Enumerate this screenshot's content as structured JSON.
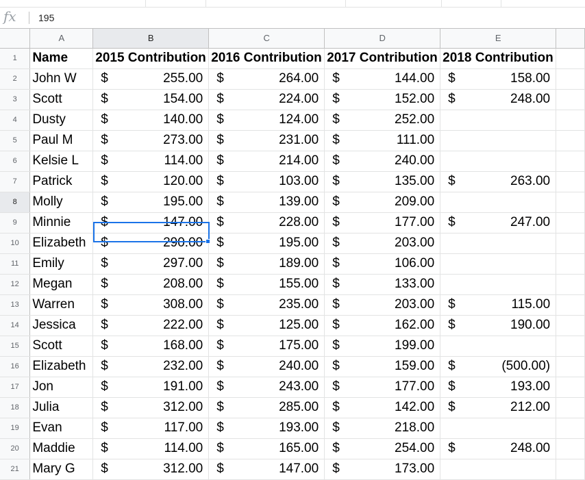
{
  "formula_bar": {
    "fx_label": "fx",
    "value": "195"
  },
  "columns": [
    "A",
    "B",
    "C",
    "D",
    "E"
  ],
  "header": [
    "Name",
    "2015 Contribution",
    "2016 Contribution",
    "2017 Contribution",
    "2018 Contribution"
  ],
  "selected": {
    "row": 8,
    "col": "B"
  },
  "rows": [
    {
      "num": "2",
      "name": "John W",
      "vals": [
        "255.00",
        "264.00",
        "144.00",
        "158.00"
      ]
    },
    {
      "num": "3",
      "name": "Scott",
      "vals": [
        "154.00",
        "224.00",
        "152.00",
        "248.00"
      ]
    },
    {
      "num": "4",
      "name": "Dusty",
      "vals": [
        "140.00",
        "124.00",
        "252.00",
        ""
      ]
    },
    {
      "num": "5",
      "name": "Paul M",
      "vals": [
        "273.00",
        "231.00",
        "111.00",
        ""
      ]
    },
    {
      "num": "6",
      "name": "Kelsie L",
      "vals": [
        "114.00",
        "214.00",
        "240.00",
        ""
      ]
    },
    {
      "num": "7",
      "name": "Patrick",
      "vals": [
        "120.00",
        "103.00",
        "135.00",
        "263.00"
      ]
    },
    {
      "num": "8",
      "name": "Molly",
      "vals": [
        "195.00",
        "139.00",
        "209.00",
        ""
      ]
    },
    {
      "num": "9",
      "name": "Minnie",
      "vals": [
        "147.00",
        "228.00",
        "177.00",
        "247.00"
      ]
    },
    {
      "num": "10",
      "name": "Elizabeth",
      "vals": [
        "290.00",
        "195.00",
        "203.00",
        ""
      ]
    },
    {
      "num": "11",
      "name": "Emily",
      "vals": [
        "297.00",
        "189.00",
        "106.00",
        ""
      ]
    },
    {
      "num": "12",
      "name": "Megan",
      "vals": [
        "208.00",
        "155.00",
        "133.00",
        ""
      ]
    },
    {
      "num": "13",
      "name": "Warren",
      "vals": [
        "308.00",
        "235.00",
        "203.00",
        "115.00"
      ]
    },
    {
      "num": "14",
      "name": "Jessica",
      "vals": [
        "222.00",
        "125.00",
        "162.00",
        "190.00"
      ]
    },
    {
      "num": "15",
      "name": "Scott",
      "vals": [
        "168.00",
        "175.00",
        "199.00",
        ""
      ]
    },
    {
      "num": "16",
      "name": "Elizabeth",
      "vals": [
        "232.00",
        "240.00",
        "159.00",
        "(500.00)"
      ]
    },
    {
      "num": "17",
      "name": "Jon",
      "vals": [
        "191.00",
        "243.00",
        "177.00",
        "193.00"
      ]
    },
    {
      "num": "18",
      "name": "Julia",
      "vals": [
        "312.00",
        "285.00",
        "142.00",
        "212.00"
      ]
    },
    {
      "num": "19",
      "name": "Evan",
      "vals": [
        "117.00",
        "193.00",
        "218.00",
        ""
      ]
    },
    {
      "num": "20",
      "name": "Maddie",
      "vals": [
        "114.00",
        "165.00",
        "254.00",
        "248.00"
      ]
    },
    {
      "num": "21",
      "name": "Mary G",
      "vals": [
        "312.00",
        "147.00",
        "173.00",
        ""
      ]
    }
  ]
}
